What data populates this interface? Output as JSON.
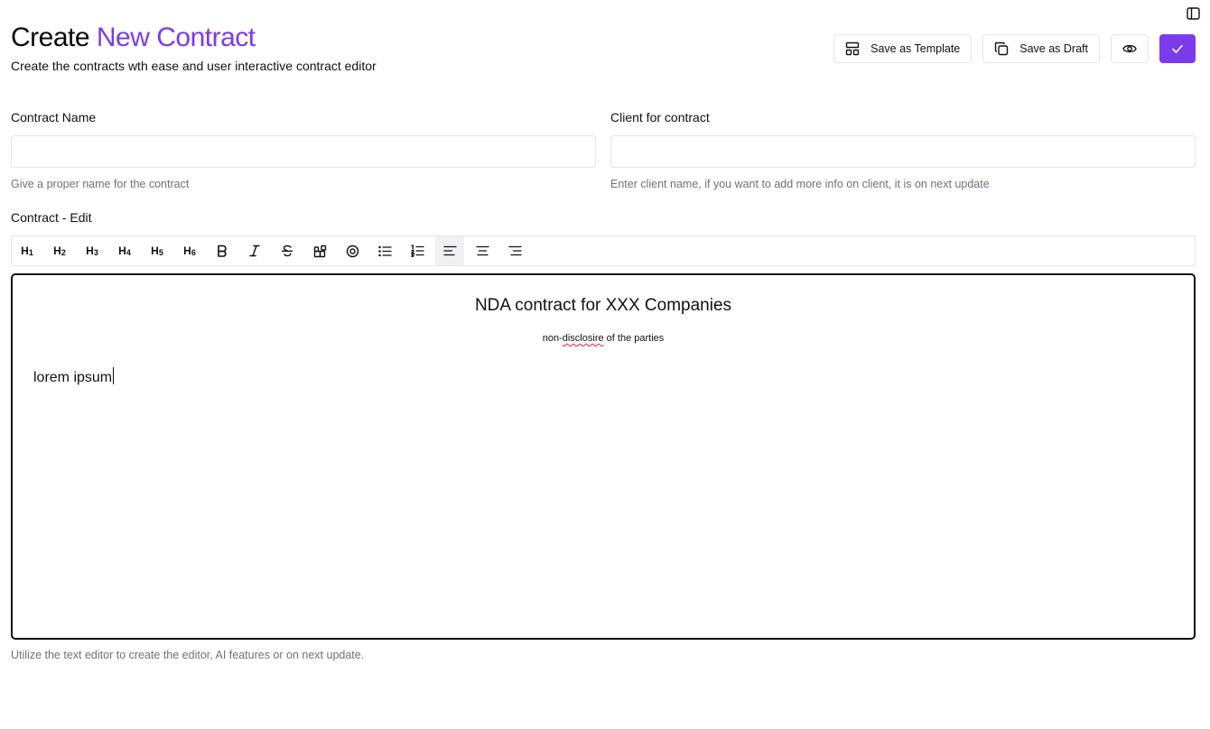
{
  "header": {
    "title_main": "Create",
    "title_accent": "New Contract",
    "subtitle": "Create the contracts wth ease and user interactive contract editor"
  },
  "actions": {
    "save_template": "Save as Template",
    "save_draft": "Save as Draft"
  },
  "form": {
    "contract_name": {
      "label": "Contract Name",
      "value": "",
      "placeholder": "",
      "hint": "Give a proper name for the contract"
    },
    "client": {
      "label": "Client for contract",
      "value": "",
      "placeholder": "",
      "hint": "Enter client name, if you want to add more info on client, it is on next update"
    }
  },
  "editor": {
    "label": "Contract - Edit",
    "toolbar": [
      {
        "name": "heading-1",
        "glyph": "H",
        "sub": "1"
      },
      {
        "name": "heading-2",
        "glyph": "H",
        "sub": "2"
      },
      {
        "name": "heading-3",
        "glyph": "H",
        "sub": "3"
      },
      {
        "name": "heading-4",
        "glyph": "H",
        "sub": "4"
      },
      {
        "name": "heading-5",
        "glyph": "H",
        "sub": "5"
      },
      {
        "name": "heading-6",
        "glyph": "H",
        "sub": "6"
      }
    ],
    "content": {
      "heading": "NDA contract for XXX Companies",
      "sub_prefix": "non-",
      "sub_misspelled": "disclosire",
      "sub_suffix": " of the parties",
      "paragraph": "lorem ipsum"
    },
    "hint": "Utilize the text editor to create the editor, AI features or on next update."
  },
  "colors": {
    "accent": "#7c3aed",
    "border": "#e4e4e7",
    "muted_text": "#71717a",
    "spellcheck": "#e11d48"
  },
  "icons": [
    "sidebar-toggle-icon",
    "template-icon",
    "copy-icon",
    "eye-icon",
    "check-icon",
    "bold-icon",
    "italic-icon",
    "strikethrough-icon",
    "blocks-icon",
    "circle-dot-icon",
    "bullet-list-icon",
    "ordered-list-icon",
    "align-left-icon",
    "align-center-icon",
    "align-right-icon"
  ]
}
